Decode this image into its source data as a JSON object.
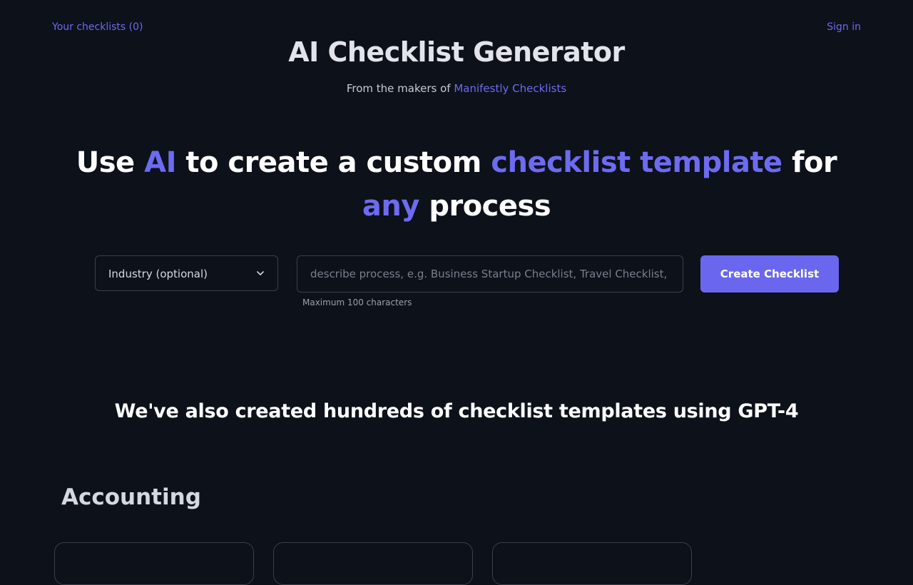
{
  "nav": {
    "your_checklists": "Your checklists (0)",
    "sign_in": "Sign in"
  },
  "header": {
    "title": "AI Checklist Generator",
    "makers_prefix": "From the makers of",
    "makers_link": "Manifestly Checklists"
  },
  "hero": {
    "part1": "Use ",
    "accent1": "AI",
    "part2": " to create a custom ",
    "accent2": "checklist template",
    "part3": " for ",
    "accent3": "any",
    "part4": " process"
  },
  "form": {
    "industry_selected": "Industry (optional)",
    "process_placeholder": "describe process, e.g. Business Startup Checklist, Travel Checklist, etc.",
    "process_value": "",
    "create_label": "Create Checklist",
    "hint": "Maximum 100 characters"
  },
  "templates": {
    "intro": "We've also created hundreds of checklist templates using GPT-4",
    "section": "Accounting"
  },
  "colors": {
    "background": "#0d111a",
    "accent": "#6d6bf0",
    "button": "#6a67ee",
    "border": "#3a3f4c"
  }
}
